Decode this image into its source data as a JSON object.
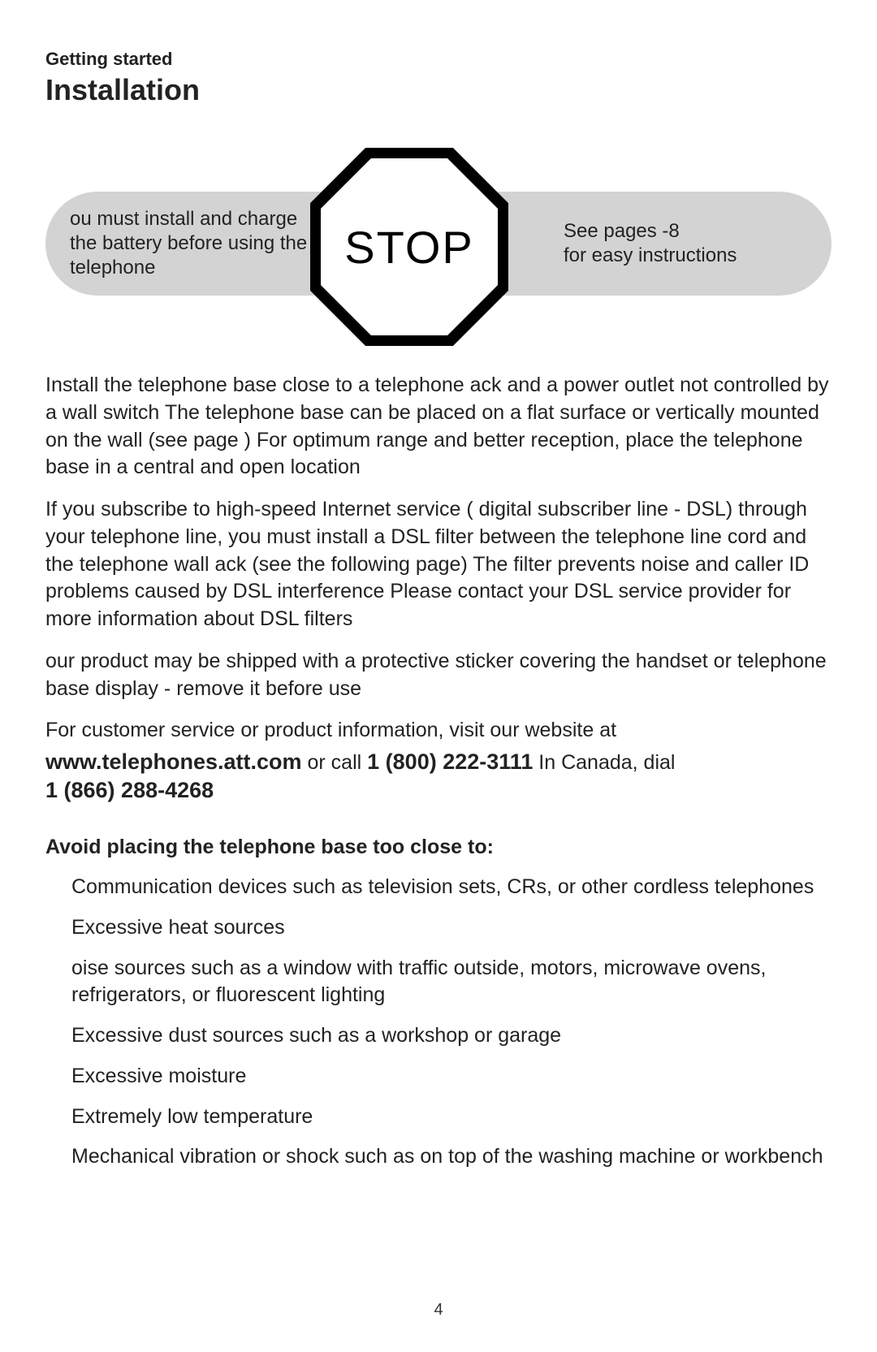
{
  "header": {
    "section": "Getting started",
    "title": "Installation"
  },
  "stop": {
    "left": "ou must install and charge the battery before using the telephone",
    "sign": "STOP",
    "right_line1": "See pages   -8",
    "right_line2": "for easy instructions"
  },
  "paragraphs": {
    "p1": "Install the telephone base close to a telephone ack and a power outlet not controlled by a wall switch  The telephone base can be placed on a flat surface or vertically mounted on the wall (see    page   )  For optimum range and better reception, place the telephone base in a central and open location",
    "p2": "If you subscribe to high-speed Internet service (    digital subscriber line -   DSL) through your telephone line, you must install a DSL filter between the telephone line cord and the telephone wall ack (see     the following page)   The filter prevents noise and caller ID problems caused by DSL interference  Please contact your DSL service provider for more information about DSL filters",
    "p3": "our product may be shipped with a protective sticker covering the handset or telephone base display - remove it before use",
    "cs": "For customer service or product information, visit our website at"
  },
  "contact": {
    "website": "www.telephones.att.com",
    "or_call": "   or call  ",
    "phone_us": "1 (800) 222-3111",
    "canada_label": "   In Canada, dial",
    "phone_ca": "1 (866) 288-4268"
  },
  "avoid": {
    "heading": "Avoid placing the telephone base too close to:",
    "items": [
      "Communication devices such as television sets, CRs, or other cordless telephones",
      "Excessive heat sources",
      "oise sources such as a window with traffic outside, motors, microwave ovens, refrigerators, or fluorescent lighting",
      "Excessive dust sources such as a workshop or garage",
      "Excessive moisture",
      "Extremely low temperature",
      "Mechanical vibration or shock such as on top of the washing machine or workbench"
    ]
  },
  "page_number": "4"
}
